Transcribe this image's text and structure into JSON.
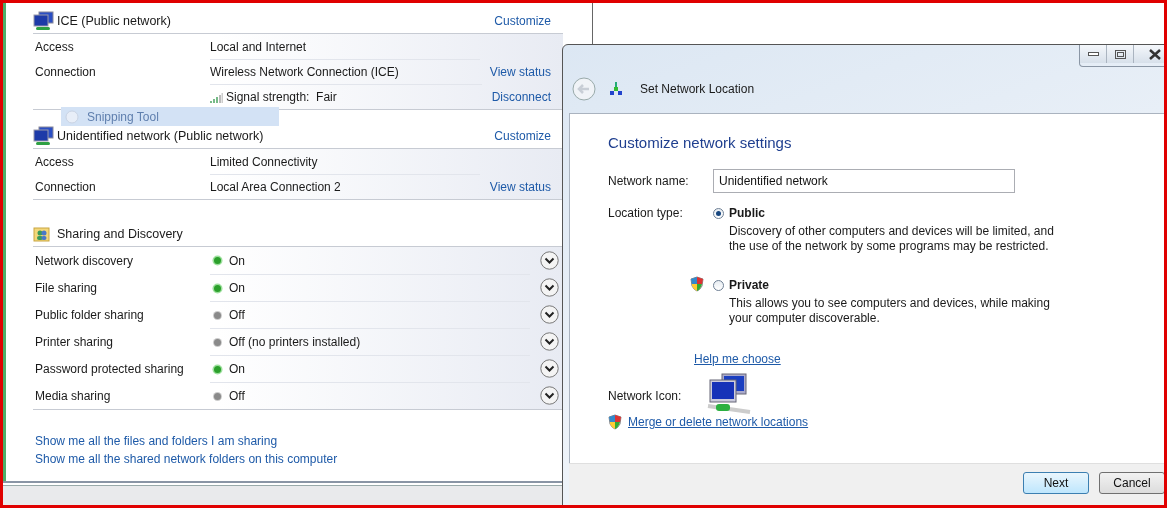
{
  "networks": [
    {
      "name": "ICE (Public network)",
      "customize": "Customize",
      "rows": [
        {
          "kind": "text",
          "label": "Access",
          "value": "Local and Internet"
        },
        {
          "kind": "text",
          "label": "Connection",
          "value": "Wireless Network Connection (ICE)",
          "action": "View status"
        },
        {
          "kind": "signal",
          "value": "Signal strength:  Fair",
          "action": "Disconnect"
        }
      ]
    },
    {
      "name": "Unidentified network (Public network)",
      "customize": "Customize",
      "rows": [
        {
          "kind": "text",
          "label": "Access",
          "value": "Limited Connectivity"
        },
        {
          "kind": "text",
          "label": "Connection",
          "value": "Local Area Connection 2",
          "action": "View status"
        }
      ]
    }
  ],
  "ghost_label": "Snipping Tool",
  "sharing": {
    "title": "Sharing and Discovery",
    "items": [
      {
        "label": "Network discovery",
        "status": "On",
        "on": true
      },
      {
        "label": "File sharing",
        "status": "On",
        "on": true
      },
      {
        "label": "Public folder sharing",
        "status": "Off",
        "on": false
      },
      {
        "label": "Printer sharing",
        "status": "Off (no printers installed)",
        "on": false
      },
      {
        "label": "Password protected sharing",
        "status": "On",
        "on": true
      },
      {
        "label": "Media sharing",
        "status": "Off",
        "on": false
      }
    ]
  },
  "links": [
    "Show me all the files and folders I am sharing",
    "Show me all the shared network folders on this computer"
  ],
  "dialog": {
    "title": "Set Network Location",
    "heading": "Customize network settings",
    "network_name": {
      "label": "Network name:",
      "value": "Unidentified network"
    },
    "location_type": "Location type:",
    "options": [
      {
        "label": "Public",
        "description": "Discovery of other computers and devices will be limited, and the use of the network by some programs may be restricted.",
        "selected": true,
        "shield": false
      },
      {
        "label": "Private",
        "description": "This allows you to see computers and devices, while making your computer discoverable.",
        "selected": false,
        "shield": true
      }
    ],
    "help_link": "Help me choose",
    "network_icon_label": "Network Icon:",
    "merge_link": "Merge or delete network locations",
    "buttons": [
      {
        "label": "Next",
        "default": true
      },
      {
        "label": "Cancel",
        "default": false
      }
    ]
  }
}
